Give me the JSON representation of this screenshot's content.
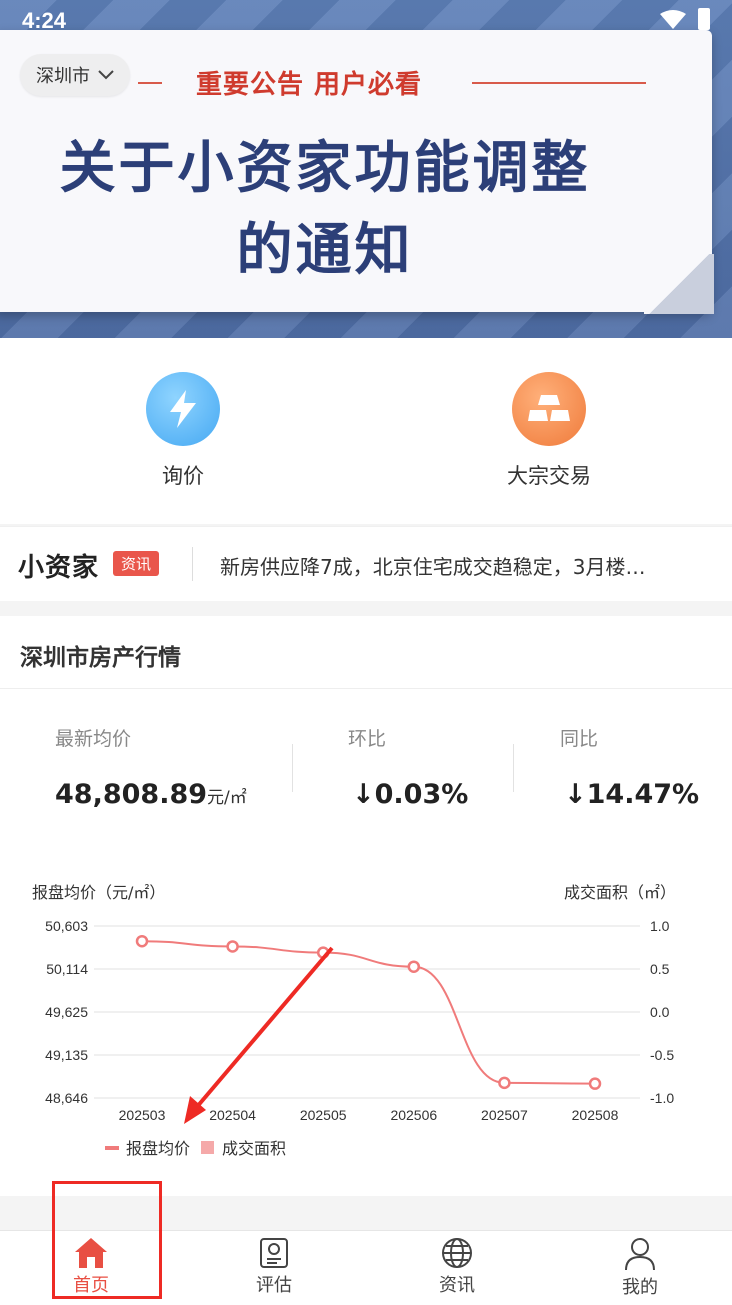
{
  "status_bar": {
    "time": "4:24"
  },
  "banner": {
    "city": "深圳市",
    "notice": "重要公告 用户必看",
    "headline_line1": "关于小资家功能调整",
    "headline_line2": "的通知"
  },
  "quick_actions": [
    {
      "label": "询价",
      "icon": "lightning-icon"
    },
    {
      "label": "大宗交易",
      "icon": "gold-bars-icon"
    }
  ],
  "news": {
    "brand": "小资家",
    "tag": "资讯",
    "headline": "新房供应降7成，北京住宅成交趋稳定，3月楼…"
  },
  "market": {
    "title": "深圳市房产行情",
    "stats": [
      {
        "label": "最新均价",
        "value": "48,808.89",
        "unit": "元/㎡"
      },
      {
        "label": "环比",
        "value": "↓0.03%"
      },
      {
        "label": "同比",
        "value": "↓14.47%"
      }
    ]
  },
  "chart_data": {
    "type": "line",
    "ylabel_left": "报盘均价（元/㎡）",
    "ylabel_right": "成交面积（㎡）",
    "categories": [
      "202503",
      "202504",
      "202505",
      "202506",
      "202507",
      "202508"
    ],
    "left_ticks": [
      "50,603",
      "50,114",
      "49,625",
      "49,135",
      "48,646"
    ],
    "right_ticks": [
      "1.0",
      "0.5",
      "0.0",
      "-0.5",
      "-1.0"
    ],
    "ylim_left": [
      48646,
      50603
    ],
    "series": [
      {
        "name": "报盘均价",
        "color": "#f07b7b",
        "values": [
          50430,
          50370,
          50300,
          50140,
          48818,
          48808.89
        ]
      },
      {
        "name": "成交面积",
        "color": "#f5a9a9",
        "values": []
      }
    ],
    "legend": "bottom-left",
    "grid": true
  },
  "nav": [
    {
      "label": "首页",
      "icon": "home-icon",
      "active": true
    },
    {
      "label": "评估",
      "icon": "appraisal-icon",
      "active": false
    },
    {
      "label": "资讯",
      "icon": "globe-icon",
      "active": false
    },
    {
      "label": "我的",
      "icon": "profile-icon",
      "active": false
    }
  ],
  "colors": {
    "accent": "#e84f43",
    "line": "#f07b7b",
    "highlight": "#ee2a24"
  }
}
